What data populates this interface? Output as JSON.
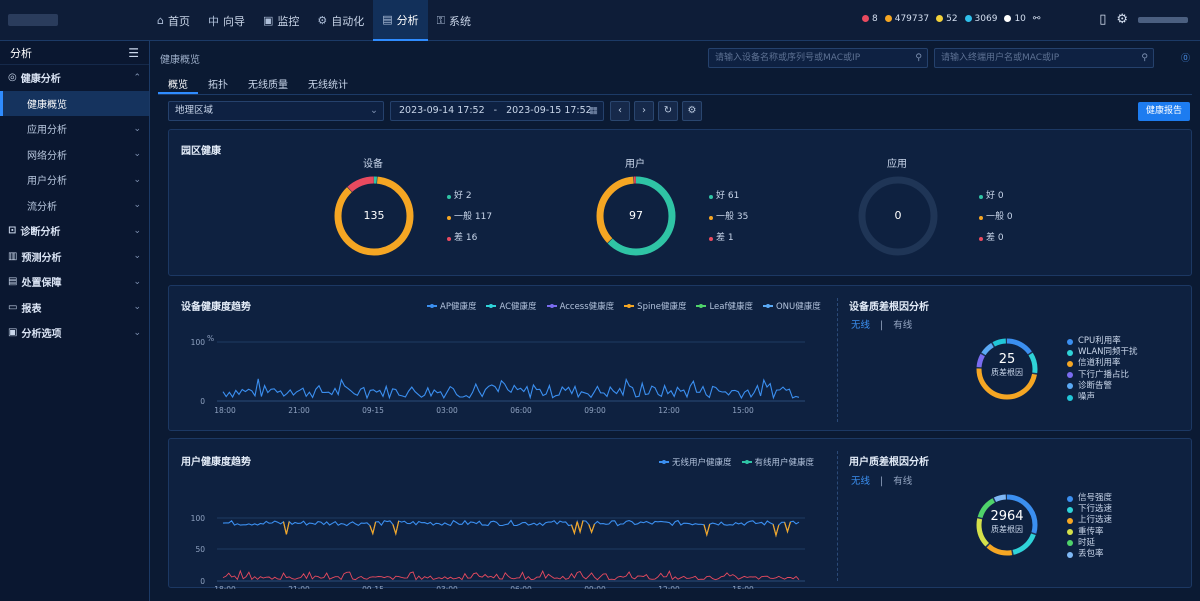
{
  "nav": {
    "items": [
      {
        "label": "首页",
        "icon": "home-icon",
        "glyph": "⌂"
      },
      {
        "label": "向导",
        "icon": "guide-icon",
        "glyph": "中"
      },
      {
        "label": "监控",
        "icon": "monitor-icon",
        "glyph": "▣"
      },
      {
        "label": "自动化",
        "icon": "automation-icon",
        "glyph": "⚙"
      },
      {
        "label": "分析",
        "icon": "analysis-icon",
        "glyph": "▤"
      },
      {
        "label": "系统",
        "icon": "system-icon",
        "glyph": "⚿"
      }
    ],
    "active_index": 4
  },
  "status": {
    "items": [
      {
        "value": "8",
        "color": "#e84a5f"
      },
      {
        "value": "479737",
        "color": "#f5a623"
      },
      {
        "value": "52",
        "color": "#f2d13a"
      },
      {
        "value": "3069",
        "color": "#2fbfea"
      },
      {
        "value": "10",
        "color": "#ffffff"
      }
    ]
  },
  "sidebar": {
    "title": "分析",
    "items": [
      {
        "label": "健康分析",
        "type": "group",
        "icon": "health-icon",
        "expanded": true
      },
      {
        "label": "健康概览",
        "type": "sub",
        "active": true
      },
      {
        "label": "应用分析",
        "type": "sub"
      },
      {
        "label": "网络分析",
        "type": "sub"
      },
      {
        "label": "用户分析",
        "type": "sub"
      },
      {
        "label": "流分析",
        "type": "sub"
      },
      {
        "label": "诊断分析",
        "type": "group",
        "icon": "diagnose-icon"
      },
      {
        "label": "预测分析",
        "type": "group",
        "icon": "predict-icon"
      },
      {
        "label": "处置保障",
        "type": "group",
        "icon": "assurance-icon"
      },
      {
        "label": "报表",
        "type": "group",
        "icon": "report-icon"
      },
      {
        "label": "分析选项",
        "type": "group",
        "icon": "options-icon"
      }
    ]
  },
  "breadcrumb": "健康概览",
  "search": {
    "device_placeholder": "请输入设备名称或序列号或MAC或IP",
    "user_placeholder": "请输入终端用户名或MAC或IP"
  },
  "tabs": [
    "概览",
    "拓扑",
    "无线质量",
    "无线统计"
  ],
  "filter": {
    "region": "地理区域",
    "start": "2023-09-14 17:52",
    "sep": "-",
    "end": "2023-09-15 17:52"
  },
  "report_button": "健康报告",
  "campus": {
    "title": "园区健康",
    "donuts": [
      {
        "label": "设备",
        "total": "135",
        "legend": [
          {
            "text": "好 2",
            "color": "#2fc4a5"
          },
          {
            "text": "一般 117",
            "color": "#f5a623"
          },
          {
            "text": "差 16",
            "color": "#e84a5f"
          }
        ],
        "segments": [
          {
            "value": 2,
            "color": "#2fc4a5"
          },
          {
            "value": 117,
            "color": "#f5a623"
          },
          {
            "value": 16,
            "color": "#e84a5f"
          }
        ]
      },
      {
        "label": "用户",
        "total": "97",
        "legend": [
          {
            "text": "好 61",
            "color": "#2fc4a5"
          },
          {
            "text": "一般 35",
            "color": "#f5a623"
          },
          {
            "text": "差 1",
            "color": "#e84a5f"
          }
        ],
        "segments": [
          {
            "value": 61,
            "color": "#2fc4a5"
          },
          {
            "value": 35,
            "color": "#f5a623"
          },
          {
            "value": 1,
            "color": "#e84a5f"
          }
        ]
      },
      {
        "label": "应用",
        "total": "0",
        "legend": [
          {
            "text": "好 0",
            "color": "#2fc4a5"
          },
          {
            "text": "一般 0",
            "color": "#f5a623"
          },
          {
            "text": "差 0",
            "color": "#e84a5f"
          }
        ],
        "segments": []
      }
    ]
  },
  "device_trend": {
    "title": "设备健康度趋势",
    "unit": "%",
    "legend": [
      {
        "name": "AP健康度",
        "color": "#3b8ff0"
      },
      {
        "name": "AC健康度",
        "color": "#2fd3d8"
      },
      {
        "name": "Access健康度",
        "color": "#7a6cf0"
      },
      {
        "name": "Spine健康度",
        "color": "#f5a623"
      },
      {
        "name": "Leaf健康度",
        "color": "#4fd36a"
      },
      {
        "name": "ONU健康度",
        "color": "#5aa9f5"
      }
    ],
    "y_ticks": [
      "100",
      "0"
    ],
    "x_ticks": [
      "18:00",
      "21:00",
      "09-15",
      "03:00",
      "06:00",
      "09:00",
      "12:00",
      "15:00"
    ]
  },
  "device_root": {
    "title": "设备质差根因分析",
    "subtabs": [
      "无线",
      "有线"
    ],
    "total": "25",
    "caption": "质差根因",
    "items": [
      {
        "name": "CPU利用率",
        "color": "#3b8ff0",
        "value": 4
      },
      {
        "name": "WLAN同频干扰",
        "color": "#2fd3d8",
        "value": 3
      },
      {
        "name": "信道利用率",
        "color": "#f5a623",
        "value": 12
      },
      {
        "name": "下行广播占比",
        "color": "#7a6cf0",
        "value": 2
      },
      {
        "name": "诊断告警",
        "color": "#5aa9f5",
        "value": 2
      },
      {
        "name": "噪声",
        "color": "#21c6d8",
        "value": 2
      }
    ]
  },
  "user_trend": {
    "title": "用户健康度趋势",
    "legend": [
      {
        "name": "无线用户健康度",
        "color": "#3b8ff0",
        "style": "solid"
      },
      {
        "name": "有线用户健康度",
        "color": "#2fc4a5",
        "style": "dashed"
      }
    ],
    "y_ticks": [
      "100",
      "50",
      "0"
    ],
    "x_ticks": [
      "18:00",
      "21:00",
      "09-15",
      "03:00",
      "06:00",
      "09:00",
      "12:00",
      "15:00"
    ]
  },
  "user_root": {
    "title": "用户质差根因分析",
    "subtabs": [
      "无线",
      "有线"
    ],
    "total": "2964",
    "caption": "质差根因",
    "items": [
      {
        "name": "信号强度",
        "color": "#3b8ff0",
        "value": 900
      },
      {
        "name": "下行选速",
        "color": "#2fd3d8",
        "value": 500
      },
      {
        "name": "上行选速",
        "color": "#f5a623",
        "value": 450
      },
      {
        "name": "重传率",
        "color": "#d4e04a",
        "value": 500
      },
      {
        "name": "时延",
        "color": "#4fd36a",
        "value": 400
      },
      {
        "name": "丢包率",
        "color": "#7fb8f5",
        "value": 214
      }
    ]
  }
}
